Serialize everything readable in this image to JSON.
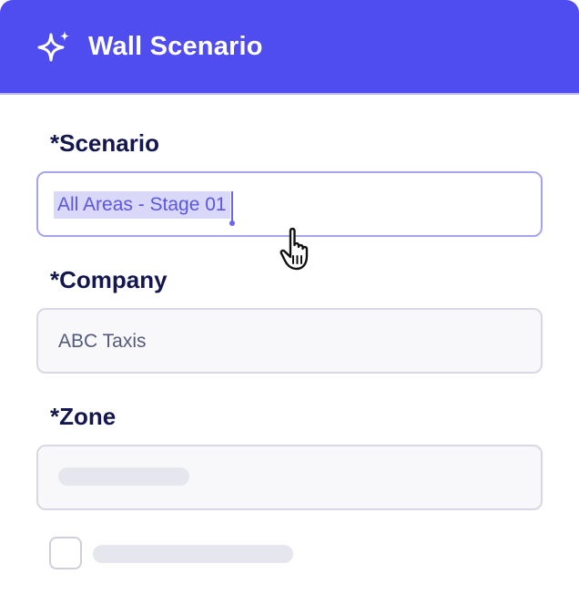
{
  "header": {
    "title": "Wall Scenario",
    "icon": "sparkles-icon",
    "background_color": "#4f4cf0"
  },
  "form": {
    "scenario": {
      "label": "*Scenario",
      "value": "All Areas - Stage 01",
      "selected": true
    },
    "company": {
      "label": "*Company",
      "value": "ABC Taxis"
    },
    "zone": {
      "label": "*Zone",
      "loading": true
    },
    "option": {
      "checked": false,
      "loading": true
    }
  },
  "cursor": {
    "icon": "hand-pointer-icon"
  },
  "colors": {
    "accent": "#4f4cf0",
    "label_text": "#141650",
    "selection_bg": "#d9d8f9"
  }
}
